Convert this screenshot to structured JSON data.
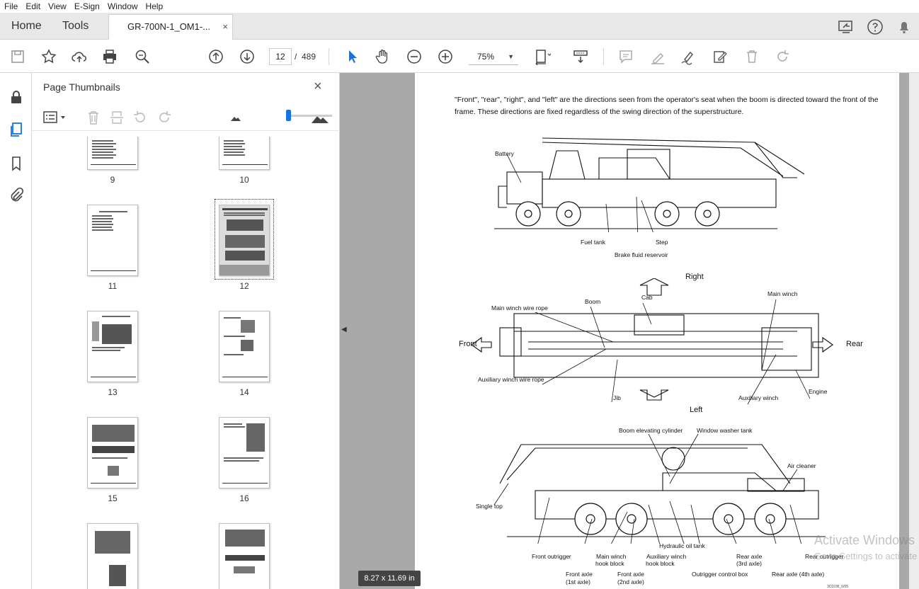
{
  "menu": [
    "File",
    "Edit",
    "View",
    "E-Sign",
    "Window",
    "Help"
  ],
  "tabs": {
    "home": "Home",
    "tools": "Tools",
    "document": "GR-700N-1_OM1-...",
    "close": "×"
  },
  "toolbar": {
    "page_current": "12",
    "page_sep": "/",
    "page_total": "489",
    "zoom": "75%",
    "zoom_caret": "▼"
  },
  "panel": {
    "title": "Page Thumbnails",
    "close": "×",
    "thumbnails": [
      "9",
      "10",
      "11",
      "12",
      "13",
      "14",
      "15",
      "16"
    ]
  },
  "document": {
    "intro": "\"Front\", \"rear\", \"right\", and \"left\" are the directions seen from the operator's seat when the boom is directed toward the front of the frame. These directions are fixed regardless of the swing direction of the superstructure.",
    "side_view": {
      "battery": "Battery",
      "fuel_tank": "Fuel tank",
      "step": "Step",
      "brake": "Brake fluid reservoir"
    },
    "top_view": {
      "right": "Right",
      "left": "Left",
      "front": "Front",
      "rear": "Rear",
      "boom": "Boom",
      "cab": "Cab",
      "main_winch": "Main winch",
      "main_rope": "Main winch wire rope",
      "aux_rope": "Auxiliary winch wire rope",
      "jib": "Jib",
      "aux_winch": "Auxiliary winch",
      "engine": "Engine"
    },
    "other_side": {
      "boom_cyl": "Boom elevating cylinder",
      "washer": "Window washer tank",
      "air": "Air cleaner",
      "single_top": "Single top",
      "front_out": "Front outrigger",
      "main_hook": "Main winch",
      "main_hook2": "hook block",
      "aux_hook": "Auxiliary winch",
      "aux_hook2": "hook block",
      "hyd": "Hydraulic oil tank",
      "rear_axle3": "Rear axle",
      "rear_axle3b": "(3rd axle)",
      "rear_out": "Rear outrigger",
      "front_axle1": "Front axle",
      "front_axle1b": "(1st axle)",
      "front_axle2": "Front axle",
      "front_axle2b": "(2nd axle)",
      "ctrl_box": "Outrigger control box",
      "rear_axle4": "Rear axle (4th axle)"
    },
    "fig_id": "3C0236_0/05"
  },
  "status": {
    "size": "8.27 x 11.69 in",
    "watermark_title": "Activate Windows",
    "watermark_sub": "Go to Settings to activate"
  }
}
